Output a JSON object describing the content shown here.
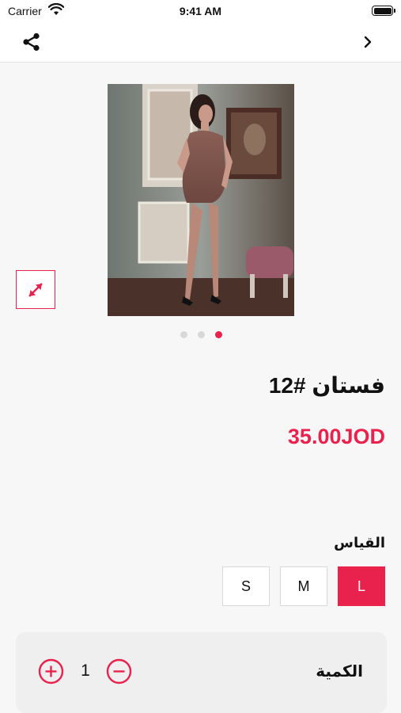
{
  "status_bar": {
    "carrier": "Carrier",
    "time": "9:41 AM"
  },
  "nav": {
    "share_icon": "share-icon",
    "back_icon": "chevron-right-icon"
  },
  "product": {
    "title": "فستان #12",
    "price": "35.00JOD",
    "image_count": 3,
    "active_image_index": 2
  },
  "size": {
    "label": "القياس",
    "options": [
      "L",
      "M",
      "S"
    ],
    "selected": "L"
  },
  "quantity": {
    "label": "الكمية",
    "value": "1"
  },
  "colors": {
    "accent": "#e8224d",
    "background": "#f7f7f7",
    "card": "#efefef"
  }
}
